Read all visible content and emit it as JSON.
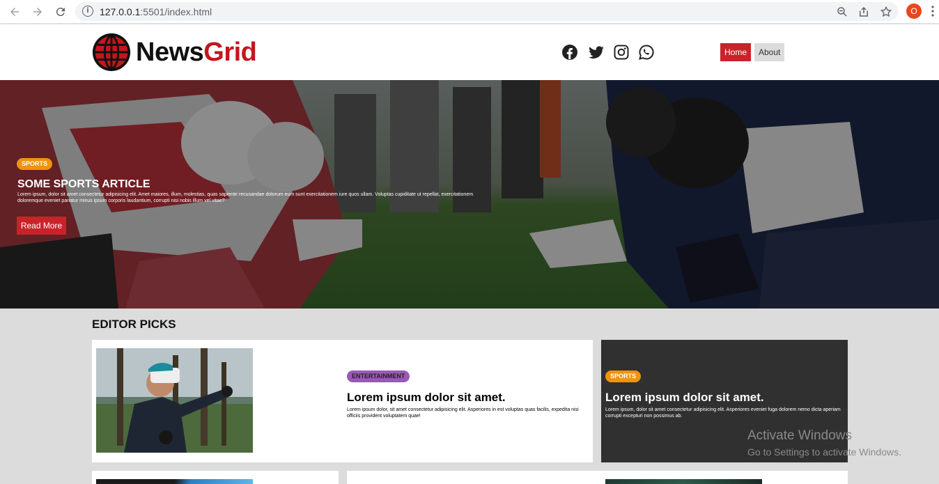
{
  "browser": {
    "url_host": "127.0.0.1",
    "url_rest": ":5501/index.html",
    "profile_initial": "O",
    "icons": [
      "back-arrow-icon",
      "forward-arrow-icon",
      "reload-icon",
      "info-icon",
      "zoom-icon",
      "share-icon",
      "bookmark-star-icon",
      "kebab-menu-icon"
    ]
  },
  "header": {
    "logo_news": "News",
    "logo_grid": "Grid",
    "social": [
      "facebook-icon",
      "twitter-icon",
      "instagram-icon",
      "whatsapp-icon"
    ],
    "menu": {
      "home": "Home",
      "about": "About"
    },
    "colors": {
      "brand_red": "#c4161c",
      "button_red": "#c9232a"
    }
  },
  "hero": {
    "category": "SPORTS",
    "title": "SOME SPORTS ARTICLE",
    "text": "Lorem ipsum, dolor sit amet consectetur adipisicing elit. Amet maiores, illum, molestias, quas sapiente recusandae dolorum eum sunt exercitationem iure quos ullam. Voluptas cupiditate ut repellat, exercitationem doloremque eveniet pariatur minus ipsum corporis laudantium, corrupti nisi nobis illum vel vitae?",
    "button": "Read More"
  },
  "editor_picks": {
    "title": "EDITOR PICKS",
    "main_card": {
      "category": "ENTERTAINMENT",
      "title": "Lorem ipsum dolor sit amet.",
      "text": "Lorem ipsum dolor, sit amet consectetur adipisicing elit. Asperiores in est voluptas quas facilis, expedita nisi officiis provident voluptatem quae!"
    },
    "side_card": {
      "category": "SPORTS",
      "title": "Lorem ipsum dolor sit amet.",
      "text": "Lorem ipsum, dolor sit amet consectetur adipisicing elit. Asperiores eveniet fuga dolorem nemo dicta aperiam corrupti excepturi non possimus ab."
    }
  },
  "overlay": {
    "line1": "Activate Windows",
    "line2": "Go to Settings to activate Windows."
  }
}
